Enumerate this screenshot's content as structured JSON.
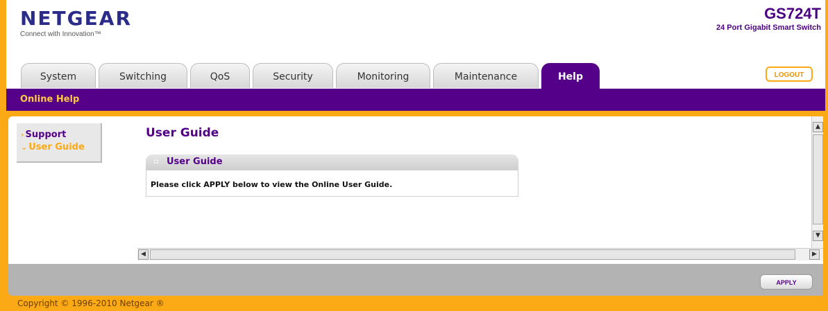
{
  "header": {
    "logo_text": "NETGEAR",
    "tagline": "Connect with Innovation™",
    "model_name": "GS724T",
    "model_description": "24 Port Gigabit Smart Switch",
    "logout_label": "LOGOUT"
  },
  "tabs": [
    {
      "label": "System",
      "active": false
    },
    {
      "label": "Switching",
      "active": false
    },
    {
      "label": "QoS",
      "active": false
    },
    {
      "label": "Security",
      "active": false
    },
    {
      "label": "Monitoring",
      "active": false
    },
    {
      "label": "Maintenance",
      "active": false
    },
    {
      "label": "Help",
      "active": true
    }
  ],
  "subnav": {
    "items": [
      {
        "label": "Online Help"
      }
    ]
  },
  "sidebar": {
    "items": [
      {
        "label": "Support",
        "selected": false
      },
      {
        "label": "User Guide",
        "selected": true
      }
    ]
  },
  "main": {
    "title": "User Guide",
    "panel_title": "User Guide",
    "panel_text": "Please click APPLY below to view the Online User Guide."
  },
  "actions": {
    "apply_label": "APPLY"
  },
  "footer": {
    "copyright": "Copyright © 1996-2010 Netgear ®"
  },
  "colors": {
    "brand_orange": "#fbaa16",
    "brand_purple": "#550088",
    "logo_blue": "#2b2b8a"
  }
}
